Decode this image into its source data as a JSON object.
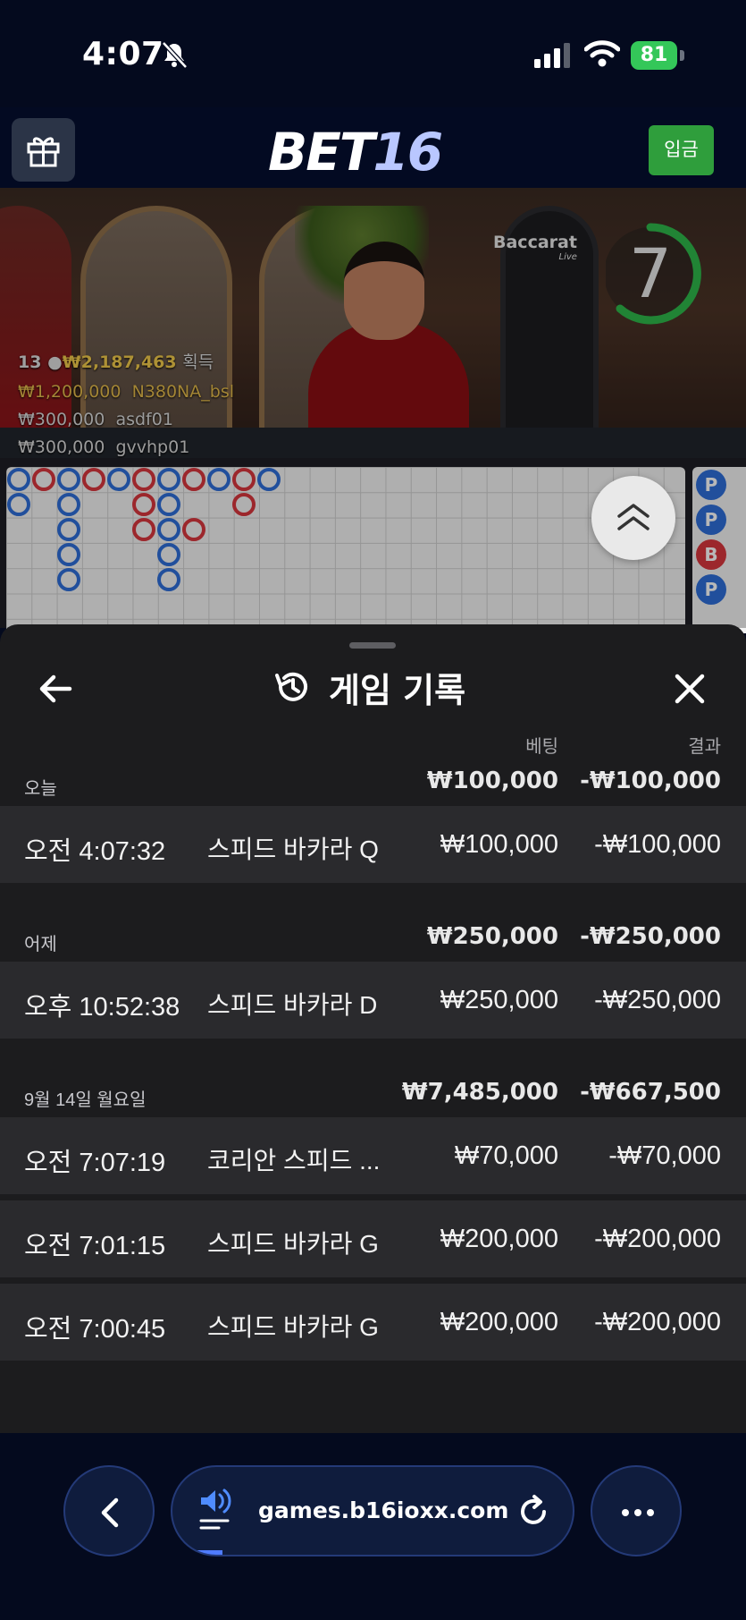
{
  "status_bar": {
    "time": "4:07",
    "battery": "81"
  },
  "header": {
    "logo_bet": "BET",
    "logo_num": "16",
    "deposit_label": "입금"
  },
  "video": {
    "sign": "Baccarat",
    "sign_sub": "Live",
    "timer": "7",
    "winners_count": "13",
    "winners_total": "₩2,187,463",
    "winners_suffix": "획득",
    "winners": [
      {
        "amount": "₩1,200,000",
        "user": "N380NA_bsl"
      },
      {
        "amount": "₩300,000",
        "user": "asdf01"
      },
      {
        "amount": "₩300,000",
        "user": "gvvhp01"
      }
    ]
  },
  "roadmap": {
    "side": [
      "P",
      "P",
      "B",
      "P"
    ]
  },
  "history": {
    "title": "게임 기록",
    "col_bet": "베팅",
    "col_result": "결과",
    "groups": [
      {
        "label": "오늘",
        "bet": "₩100,000",
        "result": "-₩100,000",
        "rows": [
          {
            "time": "오전 4:07:32",
            "game": "스피드 바카라 Q",
            "bet": "₩100,000",
            "result": "-₩100,000"
          }
        ]
      },
      {
        "label": "어제",
        "bet": "₩250,000",
        "result": "-₩250,000",
        "rows": [
          {
            "time": "오후 10:52:38",
            "game": "스피드 바카라 D",
            "bet": "₩250,000",
            "result": "-₩250,000"
          }
        ]
      },
      {
        "label": "9월 14일 월요일",
        "bet": "₩7,485,000",
        "result": "-₩667,500",
        "rows": [
          {
            "time": "오전 7:07:19",
            "game": "코리안 스피드 ...",
            "bet": "₩70,000",
            "result": "-₩70,000"
          },
          {
            "time": "오전 7:01:15",
            "game": "스피드 바카라 G",
            "bet": "₩200,000",
            "result": "-₩200,000"
          },
          {
            "time": "오전 7:00:45",
            "game": "스피드 바카라 G",
            "bet": "₩200,000",
            "result": "-₩200,000"
          }
        ]
      }
    ]
  },
  "browser": {
    "url": "games.b16ioxx.com"
  },
  "icons": [
    "bell-slash-icon",
    "signal-icon",
    "wifi-icon",
    "battery-icon",
    "gift-icon",
    "chevron-up-double-icon",
    "back-arrow-icon",
    "history-icon",
    "close-icon",
    "chevron-left-icon",
    "sound-icon",
    "reload-icon",
    "more-icon"
  ],
  "colors": {
    "accent_green": "#2f9e3c",
    "banker_red": "#d9363e",
    "player_blue": "#2f6ed8",
    "sheet_bg": "#1c1c1e"
  }
}
